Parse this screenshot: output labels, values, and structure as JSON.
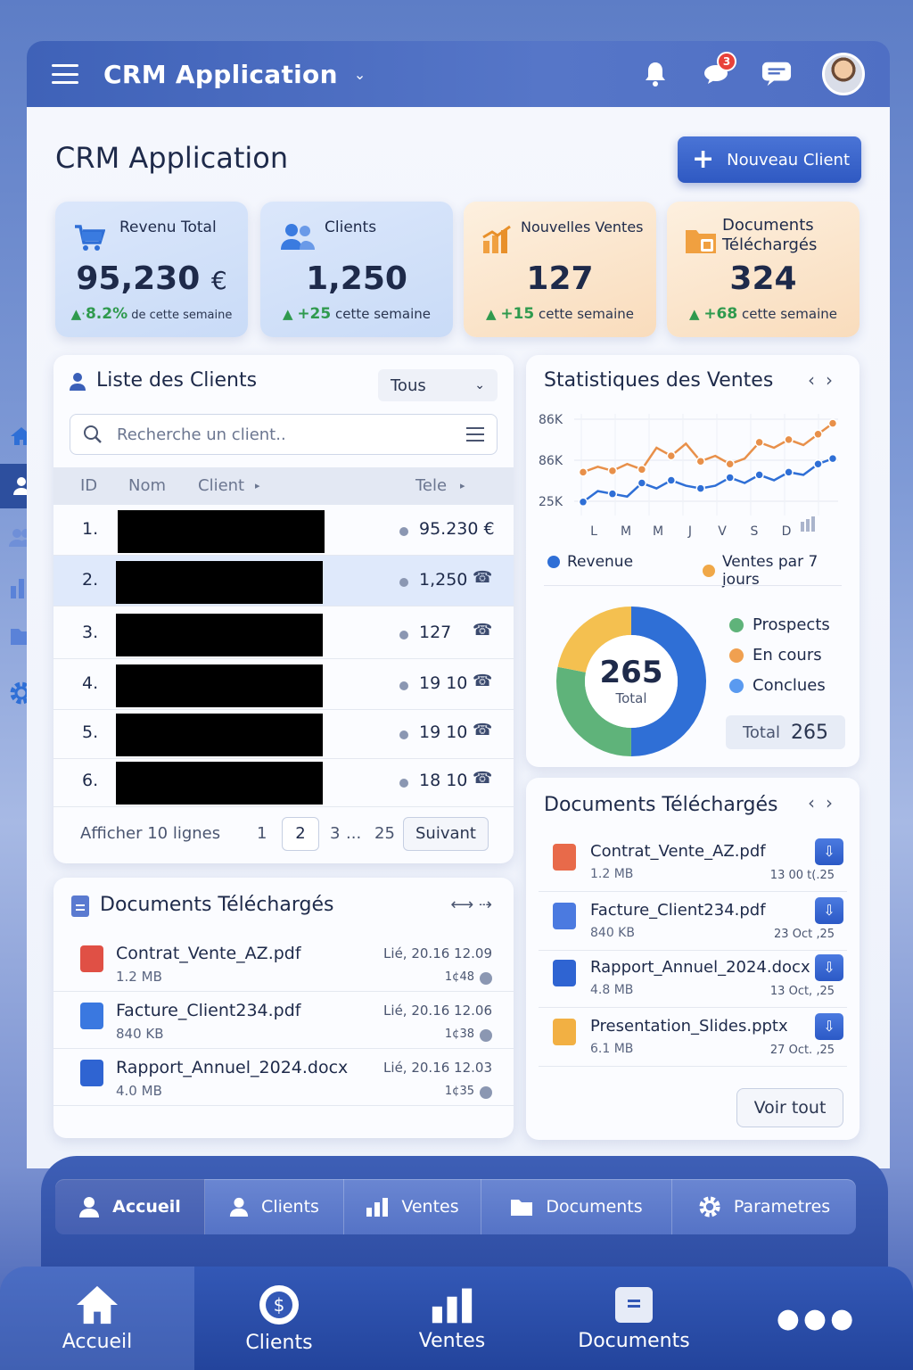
{
  "header": {
    "app_title": "CRM Application",
    "notif_count": "3"
  },
  "page": {
    "title": "CRM Application",
    "new_client_label": "Nouveau Client"
  },
  "stats": [
    {
      "label": "Revenu  Total",
      "value": "95,230",
      "unit": "€",
      "trend_num": "8.2%",
      "trend_prefix": "▲·",
      "trend_text": " de cette semaine"
    },
    {
      "label": "Clients",
      "value": "1,250",
      "trend_num": "+25",
      "trend_prefix": "▲ ",
      "trend_text": " cette semaine"
    },
    {
      "label": "Nouvelles Ventes",
      "value": "127",
      "trend_num": "+15",
      "trend_prefix": "▲ ",
      "trend_text": " cette semaine"
    },
    {
      "label": "Documents Téléchargés",
      "value": "324",
      "trend_num": "+68",
      "trend_prefix": "▲ ",
      "trend_text": "  cette semaine"
    }
  ],
  "clients": {
    "title": "Liste des Clients",
    "filter": "Tous",
    "search_placeholder": "Recherche un client..",
    "columns": {
      "id": "ID",
      "name": "Nom",
      "client": "Client",
      "phone": "Tele"
    },
    "rows": [
      {
        "id": "1.",
        "value": "95.230 €"
      },
      {
        "id": "2.",
        "value": "1,250"
      },
      {
        "id": "3.",
        "value": "127"
      },
      {
        "id": "4.",
        "value": "19 10"
      },
      {
        "id": "5.",
        "value": "19 10"
      },
      {
        "id": "6.",
        "value": "18 10"
      }
    ],
    "pager": {
      "label": "Afficher 10 lignes",
      "p1": "1",
      "p2": "2",
      "p3": "3",
      "dots": "...",
      "last": "25",
      "next": "Suivant"
    }
  },
  "docs_left": {
    "title": "Documents Téléchargés",
    "items": [
      {
        "name": "Contrat_Vente_AZ.pdf",
        "size": "1.2 MB",
        "date": "Lié, 20.16 12.09",
        "time": "1¢48",
        "color": "#e05045"
      },
      {
        "name": "Facture_Client234.pdf",
        "size": "840 KB",
        "date": "Lié, 20.16 12.06",
        "time": "1¢38",
        "color": "#3a78e0"
      },
      {
        "name": "Rapport_Annuel_2024.docx",
        "size": "4.0 MB",
        "date": "Lié, 20.16 12.03",
        "time": "1¢35",
        "color": "#2f64d2"
      }
    ]
  },
  "sales": {
    "title": "Statistiques des Ventes",
    "legend_revenue": "Revenue",
    "legend_sales": "Ventes par 7 jours",
    "donut_value": "265",
    "donut_label": "Total",
    "segments": [
      {
        "label": "Prospects",
        "color": "#5fb37a"
      },
      {
        "label": "En cours",
        "color": "#f0a050"
      },
      {
        "label": "Conclues",
        "color": "#5a9af0"
      }
    ],
    "total_label": "Total",
    "total_value": "265"
  },
  "chart_data": {
    "type": "line",
    "categories": [
      "L",
      "M",
      "M",
      "J",
      "V",
      "S",
      "D"
    ],
    "yticks": [
      "86K",
      "86K",
      "25K"
    ],
    "series": [
      {
        "name": "Ventes par 7 jours",
        "color": "#e8904a",
        "values": [
          52,
          56,
          53,
          58,
          54,
          70,
          64,
          73,
          60,
          64,
          58,
          62,
          74,
          70,
          76,
          72,
          80,
          88
        ]
      },
      {
        "name": "Revenue",
        "color": "#2f6fd6",
        "values": [
          30,
          38,
          36,
          34,
          44,
          40,
          46,
          42,
          40,
          42,
          48,
          44,
          50,
          46,
          52,
          50,
          58,
          62
        ]
      }
    ]
  },
  "docs_right": {
    "title": "Documents Téléchargés",
    "see_all": "Voir tout",
    "items": [
      {
        "name": "Contrat_Vente_AZ.pdf",
        "size": "1.2 MB",
        "date": "13 00 t(.25",
        "color": "#e86a4a"
      },
      {
        "name": "Facture_Client234.pdf",
        "size": "840 KB",
        "date": "23 Oct ‚25",
        "color": "#4b7ae0"
      },
      {
        "name": "Rapport_Annuel_2024.docx",
        "size": "4.8 MB",
        "date": "13 Oct, ‚25",
        "color": "#2f64d2"
      },
      {
        "name": "Presentation_Slides.pptx",
        "size": "6.1 MB",
        "date": "27 Oct. ‚25",
        "color": "#f2b043"
      }
    ]
  },
  "subnav": [
    "Accueil",
    "Clients",
    "Ventes",
    "Documents",
    "Parametres"
  ],
  "tabs": [
    "Accueil",
    "Clients",
    "Ventes",
    "Documents"
  ]
}
